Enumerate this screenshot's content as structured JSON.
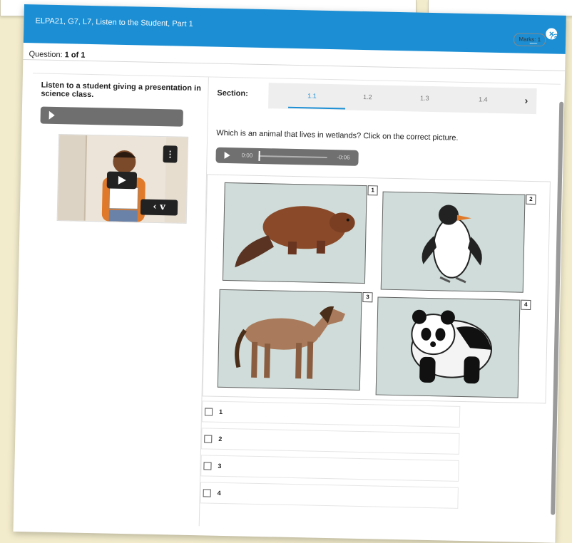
{
  "window": {
    "title": "ELPA21, G7, L7, Listen to the Student, Part 1",
    "minimize_label": "_",
    "close_label": "×",
    "accent": "#1c8fd4"
  },
  "question_bar": {
    "label": "Question:",
    "value": "1 of 1",
    "marks": "Marks: 1",
    "help": "?"
  },
  "left": {
    "prompt": "Listen to a student giving a presentation in science class.",
    "video_menu": "⋮",
    "video_logo": "‹ v"
  },
  "section": {
    "label": "Section:",
    "tabs": [
      "1.1",
      "1.2",
      "1.3",
      "1.4"
    ],
    "active_tab": "1.1",
    "next": "›"
  },
  "question": {
    "text": "Which is an animal that lives in wetlands? Click on the correct picture.",
    "clip_start": "0:00",
    "clip_end": "-0:06"
  },
  "pictures": [
    {
      "number": "1",
      "icon": "beaver-icon"
    },
    {
      "number": "2",
      "icon": "penguin-icon"
    },
    {
      "number": "3",
      "icon": "horse-icon"
    },
    {
      "number": "4",
      "icon": "panda-icon"
    }
  ],
  "options": [
    "1",
    "2",
    "3",
    "4"
  ]
}
